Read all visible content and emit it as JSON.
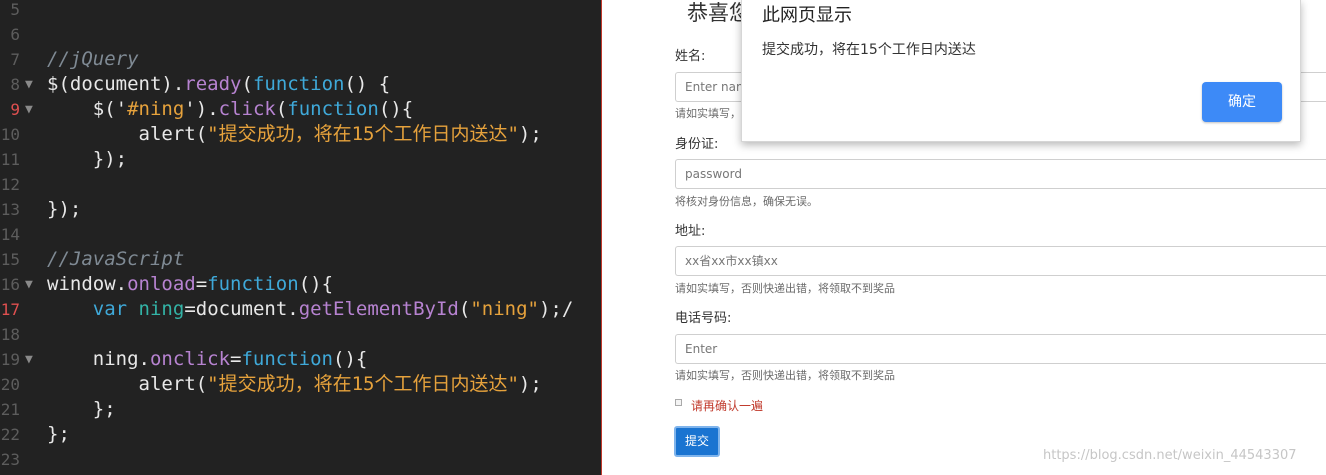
{
  "editor": {
    "lines": [
      {
        "num": "5",
        "fold": "",
        "code": ""
      },
      {
        "num": "6",
        "fold": "",
        "code": ""
      },
      {
        "num": "7",
        "fold": "",
        "code": "//jQuery"
      },
      {
        "num": "8",
        "fold": "▼",
        "code": "$(document).ready(function() {"
      },
      {
        "num": "9",
        "fold": "▼",
        "code": "    $('#ning').click(function(){"
      },
      {
        "num": "10",
        "fold": "",
        "code": "        alert(\"提交成功，将在15个工作日内送达\");"
      },
      {
        "num": "11",
        "fold": "",
        "code": "    });"
      },
      {
        "num": "12",
        "fold": "",
        "code": ""
      },
      {
        "num": "13",
        "fold": "",
        "code": "});"
      },
      {
        "num": "14",
        "fold": "",
        "code": ""
      },
      {
        "num": "15",
        "fold": "",
        "code": "//JavaScript"
      },
      {
        "num": "16",
        "fold": "▼",
        "code": "window.onload=function(){"
      },
      {
        "num": "17",
        "fold": "",
        "code": "    var ning=document.getElementById(\"ning\");/"
      },
      {
        "num": "18",
        "fold": "",
        "code": ""
      },
      {
        "num": "19",
        "fold": "▼",
        "code": "    ning.onclick=function(){"
      },
      {
        "num": "20",
        "fold": "",
        "code": "        alert(\"提交成功，将在15个工作日内送达\");"
      },
      {
        "num": "21",
        "fold": "",
        "code": "    };"
      },
      {
        "num": "22",
        "fold": "",
        "code": "};"
      },
      {
        "num": "23",
        "fold": "",
        "code": ""
      }
    ],
    "highlighted_lines": [
      "9",
      "17"
    ]
  },
  "page": {
    "heading": "恭喜您",
    "form": {
      "name_label": "姓名:",
      "name_placeholder": "Enter nam",
      "name_help": "请如实填写，",
      "id_label": "身份证:",
      "id_placeholder": "password",
      "id_help": "将核对身份信息，确保无误。",
      "address_label": "地址:",
      "address_placeholder": "xx省xx市xx镇xx",
      "address_help": "请如实填写，否则快递出错，将领取不到奖品",
      "phone_label": "电话号码:",
      "phone_placeholder": "Enter",
      "phone_help": "请如实填写，否则快递出错，将领取不到奖品",
      "confirm_label": "请再确认一遍",
      "submit_label": "提交"
    },
    "watermark": "https://blog.csdn.net/weixin_44543307"
  },
  "alert": {
    "title": "此网页显示",
    "message": "提交成功，将在15个工作日内送达",
    "ok_label": "确定"
  },
  "colors": {
    "editor_bg": "#222222",
    "keyword": "#3fa9d9",
    "function": "#b783d1",
    "string": "#e6a23c",
    "comment": "#7f8a94",
    "submit_bg": "#1a74d1",
    "ok_bg": "#3d8af7",
    "confirm_text": "#c0392b"
  }
}
